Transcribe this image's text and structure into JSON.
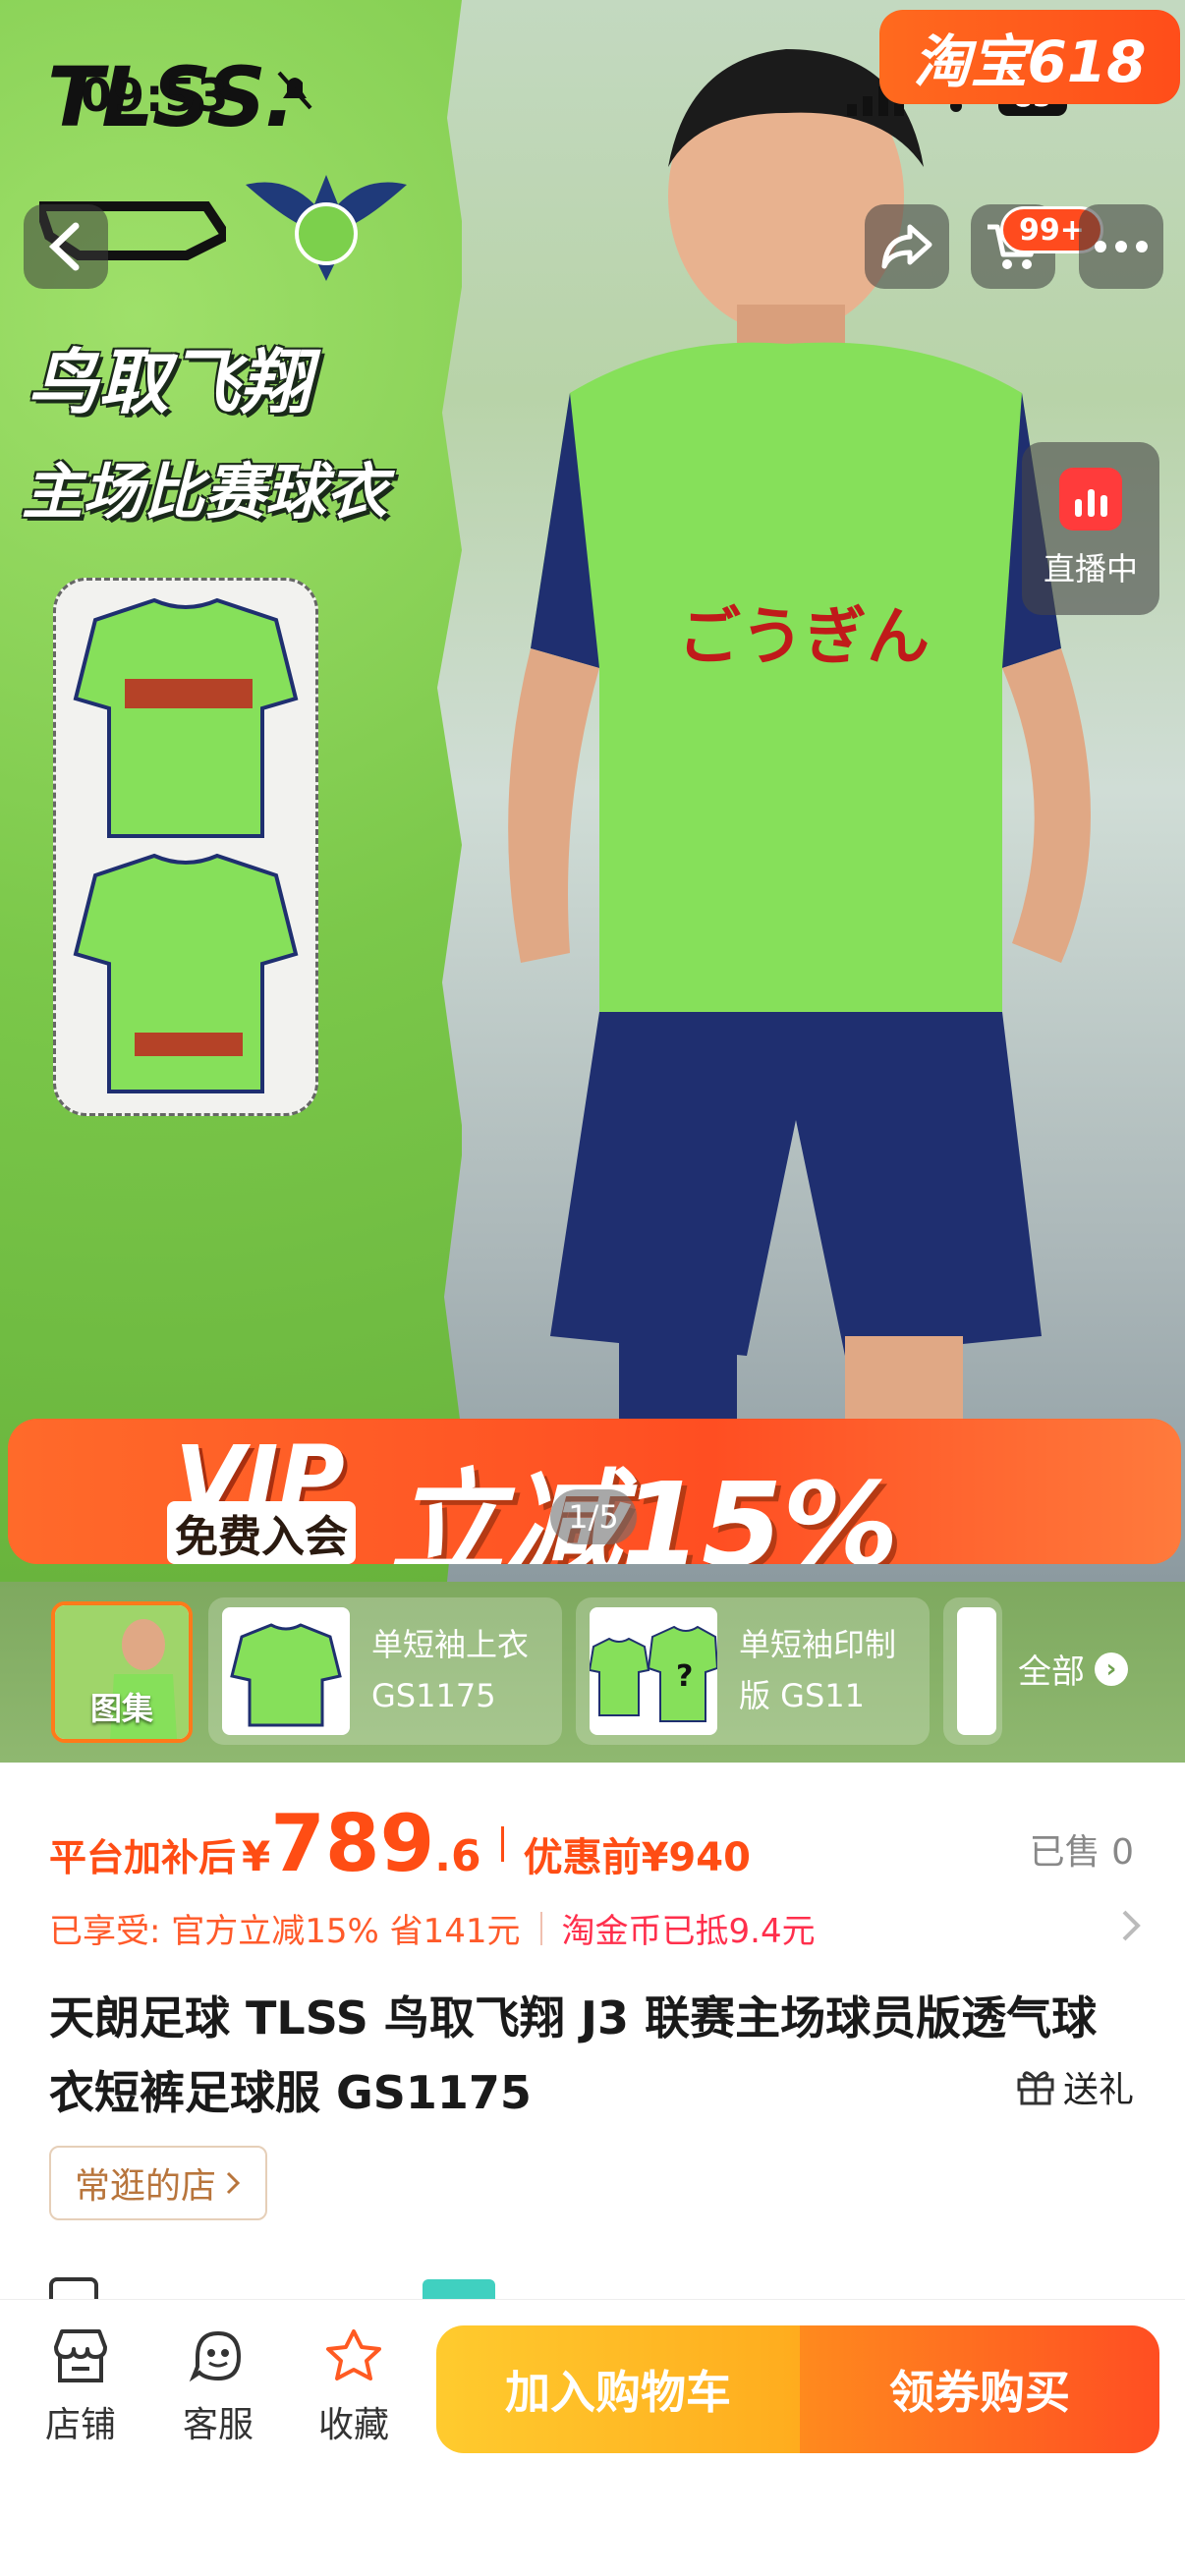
{
  "status_bar": {
    "time": "09:53",
    "battery": "85"
  },
  "taobao_badge": "淘宝618",
  "hero": {
    "brand": "TLSS.",
    "title_line1": "鸟取飞翔",
    "title_line2": "主场比赛球衣",
    "vip_word": "VIP",
    "vip_sub": "免费入会",
    "vip_offer": "立减15%",
    "pager": "1/5",
    "live_label": "直播中",
    "cart_count": "99+"
  },
  "sku": {
    "first_label": "图集",
    "items": [
      {
        "label": "单短袖上衣 GS1175"
      },
      {
        "label": "单短袖印制版 GS11"
      }
    ],
    "all_label": "全部"
  },
  "price": {
    "prefix": "平台加补后",
    "currency": "¥",
    "integer": "789",
    "decimal": ".6",
    "original": "优惠前¥940",
    "sold": "已售 0"
  },
  "discount": {
    "part1": "已享受: 官方立减15% 省141元",
    "part2": "淘金币已抵9.4元"
  },
  "product_title": "天朗足球 TLSS 鸟取飞翔 J3 联赛主场球员版透气球衣短裤足球服 GS1175",
  "gift_label": "送礼",
  "shop_tag": "常逛的店",
  "bottom_bar": {
    "store": "店铺",
    "service": "客服",
    "favorite": "收藏",
    "add_cart": "加入购物车",
    "buy": "领券购买"
  },
  "colors": {
    "accent": "#ff4d14",
    "cart_btn": "#ffbb25",
    "buy_btn": "#ff5a22",
    "hero_green": "#7bc84a"
  }
}
